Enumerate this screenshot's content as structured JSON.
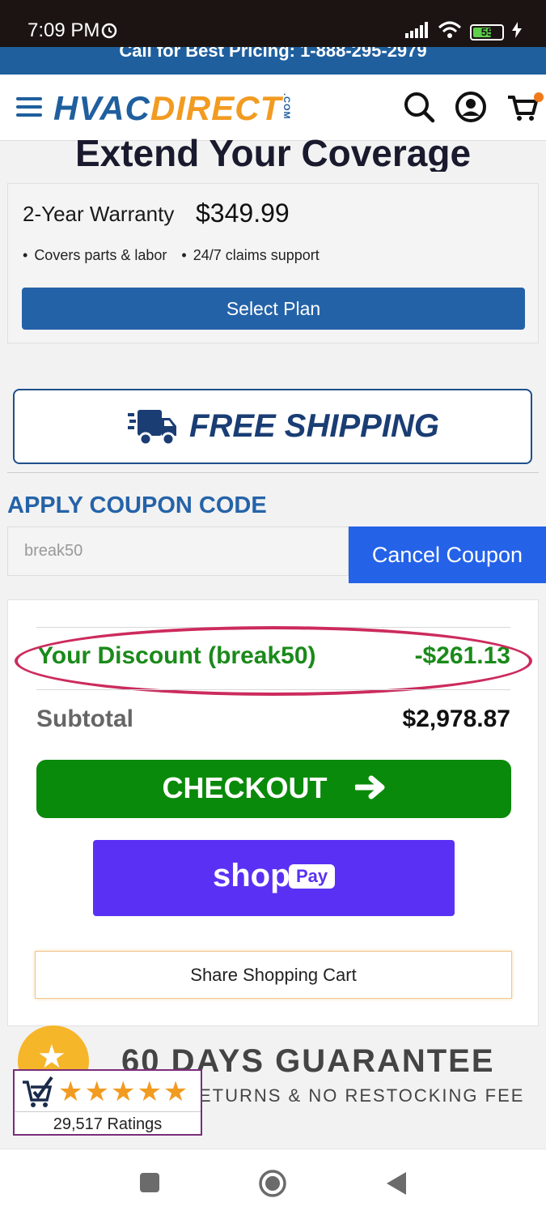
{
  "status_bar": {
    "time": "7:09 PM",
    "battery": "55"
  },
  "promo": {
    "text": "Call for Best Pricing: 1-888-295-2979"
  },
  "header": {
    "logo_part1": "HVAC",
    "logo_part2": "DIRECT",
    "logo_suffix": ".COM"
  },
  "coverage": {
    "title": "Extend Your Coverage",
    "plan_name": "2-Year Warranty",
    "plan_price": "$349.99",
    "bullets": [
      "Covers parts & labor",
      "24/7 claims support"
    ],
    "select_label": "Select Plan"
  },
  "shipping": {
    "label": "FREE SHIPPING"
  },
  "coupon": {
    "title": "APPLY COUPON CODE",
    "input_value": "break50",
    "cancel_label": "Cancel Coupon"
  },
  "summary": {
    "discount_label": "Your Discount (break50)",
    "discount_value": "-$261.13",
    "subtotal_label": "Subtotal",
    "subtotal_value": "$2,978.87",
    "checkout_label": "CHECKOUT",
    "shoppay_shop": "shop",
    "shoppay_pay": "Pay",
    "share_label": "Share Shopping Cart"
  },
  "guarantee": {
    "title": "60 DAYS GUARANTEE",
    "subtitle": "ETURNS & NO RESTOCKING FEE",
    "ratings_count": "29,517 Ratings",
    "stars": "★★★★★",
    "rating_value": 5
  },
  "colors": {
    "brand_blue": "#1f5f9e",
    "brand_orange": "#f29b21",
    "checkout_green": "#0a8a0a",
    "shoppay_purple": "#5a31f4",
    "discount_green": "#1a8a1a"
  }
}
